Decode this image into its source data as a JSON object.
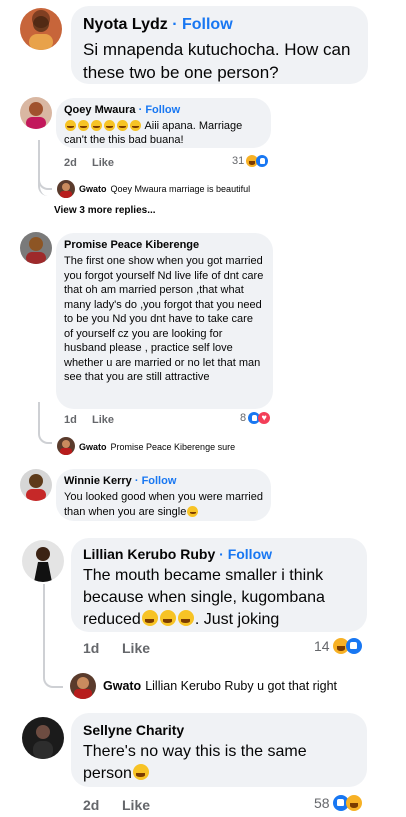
{
  "comments": [
    {
      "name": "Nyota Lydz",
      "follow": "Follow",
      "dot": "·",
      "text": "Si mnapenda kutuchocha. How can these two be one person?"
    },
    {
      "name": "Qoey Mwaura",
      "follow": "Follow",
      "dot": "·",
      "text": "Aiii apana. Marriage can't the this bad buana!",
      "time": "2d",
      "like": "Like",
      "reaction_count": "31",
      "reply": {
        "name": "Gwato",
        "text": "Qoey Mwaura marriage is beautiful"
      },
      "more_replies": "View 3 more replies..."
    },
    {
      "name": "Promise Peace Kiberenge",
      "text": "The first one show when you got married you forgot yourself Nd live life of dnt care that oh am married person ,that what many lady's do ,you forgot that you need to be you Nd you dnt have to take care of yourself cz you are looking for husband please , practice self love whether u are married or no let that man see that you are still attractive",
      "time": "1d",
      "like": "Like",
      "reaction_count": "8",
      "reply": {
        "name": "Gwato",
        "text": "Promise Peace Kiberenge sure"
      }
    },
    {
      "name": "Winnie Kerry",
      "follow": "Follow",
      "dot": "·",
      "text": "You looked good when you were married than when you are single"
    },
    {
      "name": "Lillian Kerubo Ruby",
      "follow": "Follow",
      "dot": "·",
      "text": "The mouth became smaller i think because when single, kugombana reduced",
      "text_tail": ". Just joking",
      "time": "1d",
      "like": "Like",
      "reaction_count": "14",
      "reply": {
        "name": "Gwato",
        "text": "Lillian Kerubo Ruby u got that right"
      }
    },
    {
      "name": "Sellyne Charity",
      "text": "There's no way this is the same person",
      "time": "2d",
      "like": "Like",
      "reaction_count": "58"
    }
  ],
  "colors": {
    "bubble": "#f0f2f5",
    "follow": "#1877f2",
    "meta": "#65676b",
    "like_reaction": "#1877f2",
    "haha_reaction": "#f7b125",
    "love_reaction": "#f33e58"
  }
}
